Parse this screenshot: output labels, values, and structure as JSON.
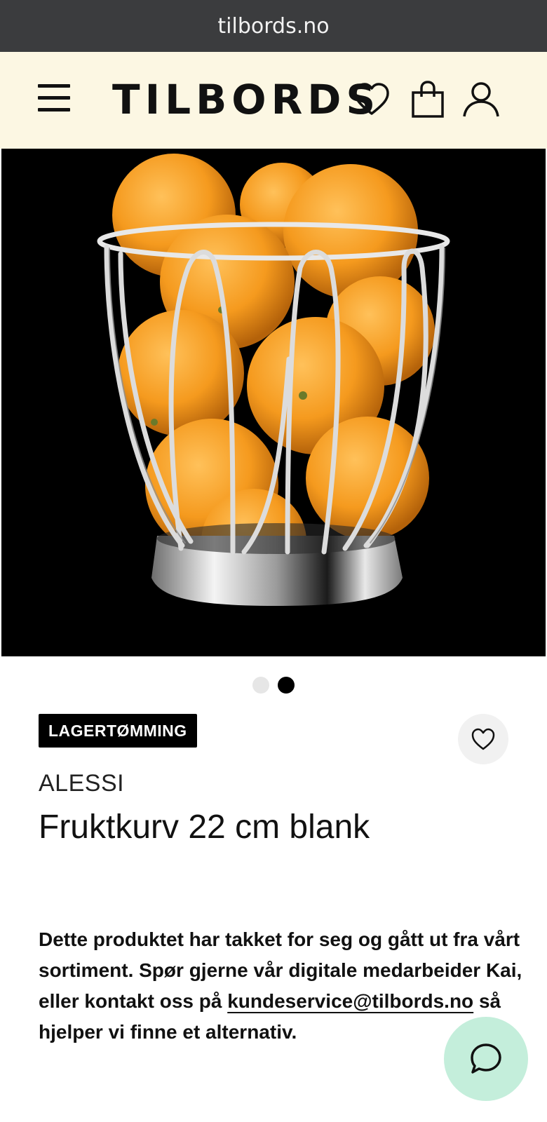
{
  "browser": {
    "url": "tilbords.no"
  },
  "header": {
    "logo": "TILBORDS",
    "icons": [
      "menu-icon",
      "heart-icon",
      "shopping-bag-icon",
      "user-icon"
    ]
  },
  "gallery": {
    "image_description_icon": "fruit-basket-image",
    "slide_count": 2,
    "active_slide": 2
  },
  "product": {
    "badge": "LAGERTØMMING",
    "brand": "ALESSI",
    "title": "Fruktkurv 22 cm blank",
    "notice_part1": "Dette produktet har takket for seg og gått ut fra vårt sortiment. Spør gjerne vår digitale medarbeider Kai, eller kontakt oss på ",
    "notice_link": "kundeservice@tilbords.no",
    "notice_part2": " så hjelper vi finne et alternativ."
  },
  "colors": {
    "header_bg": "#fcf7e3",
    "urlbar_bg": "#3b3c3e",
    "chat_bg": "#c4eedb",
    "badge_bg": "#000000"
  }
}
